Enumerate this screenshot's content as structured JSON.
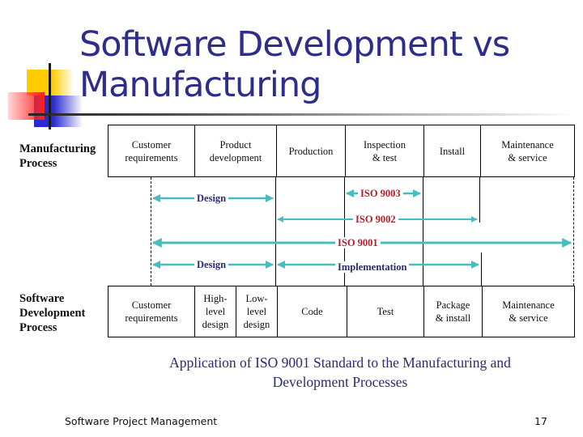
{
  "slide": {
    "title_line1": "Software Development vs",
    "title_line2": "Manufacturing",
    "accent_color": "#2e2e8a",
    "arrow_color": "#48bcc0"
  },
  "manufacturing": {
    "label_line1": "Manufacturing",
    "label_line2": "Process",
    "steps": [
      {
        "line1": "Customer",
        "line2": "requirements"
      },
      {
        "line1": "Product",
        "line2": "development"
      },
      {
        "line1": "Production",
        "line2": ""
      },
      {
        "line1": "Inspection",
        "line2": "& test"
      },
      {
        "line1": "Install",
        "line2": ""
      },
      {
        "line1": "Maintenance",
        "line2": "& service"
      }
    ]
  },
  "software": {
    "label_line1": "Software",
    "label_line2": "Development",
    "label_line3": "Process",
    "steps": [
      {
        "line1": "Customer",
        "line2": "requirements",
        "line3": ""
      },
      {
        "line1": "High-",
        "line2": "level",
        "line3": "design"
      },
      {
        "line1": "Low-",
        "line2": "level",
        "line3": "design"
      },
      {
        "line1": "Code",
        "line2": "",
        "line3": ""
      },
      {
        "line1": "Test",
        "line2": "",
        "line3": ""
      },
      {
        "line1": "Package",
        "line2": "& install",
        "line3": ""
      },
      {
        "line1": "Maintenance",
        "line2": "& service",
        "line3": ""
      }
    ]
  },
  "spans": {
    "design_top": "Design",
    "iso9003": "ISO 9003",
    "iso9002": "ISO 9002",
    "iso9001": "ISO 9001",
    "design_bottom": "Design",
    "implementation": "Implementation"
  },
  "caption": {
    "line1": "Application of ISO 9001 Standard to the Manufacturing and",
    "line2": "Development Processes"
  },
  "footer": {
    "text": "Software Project Management",
    "page_number": "17"
  }
}
